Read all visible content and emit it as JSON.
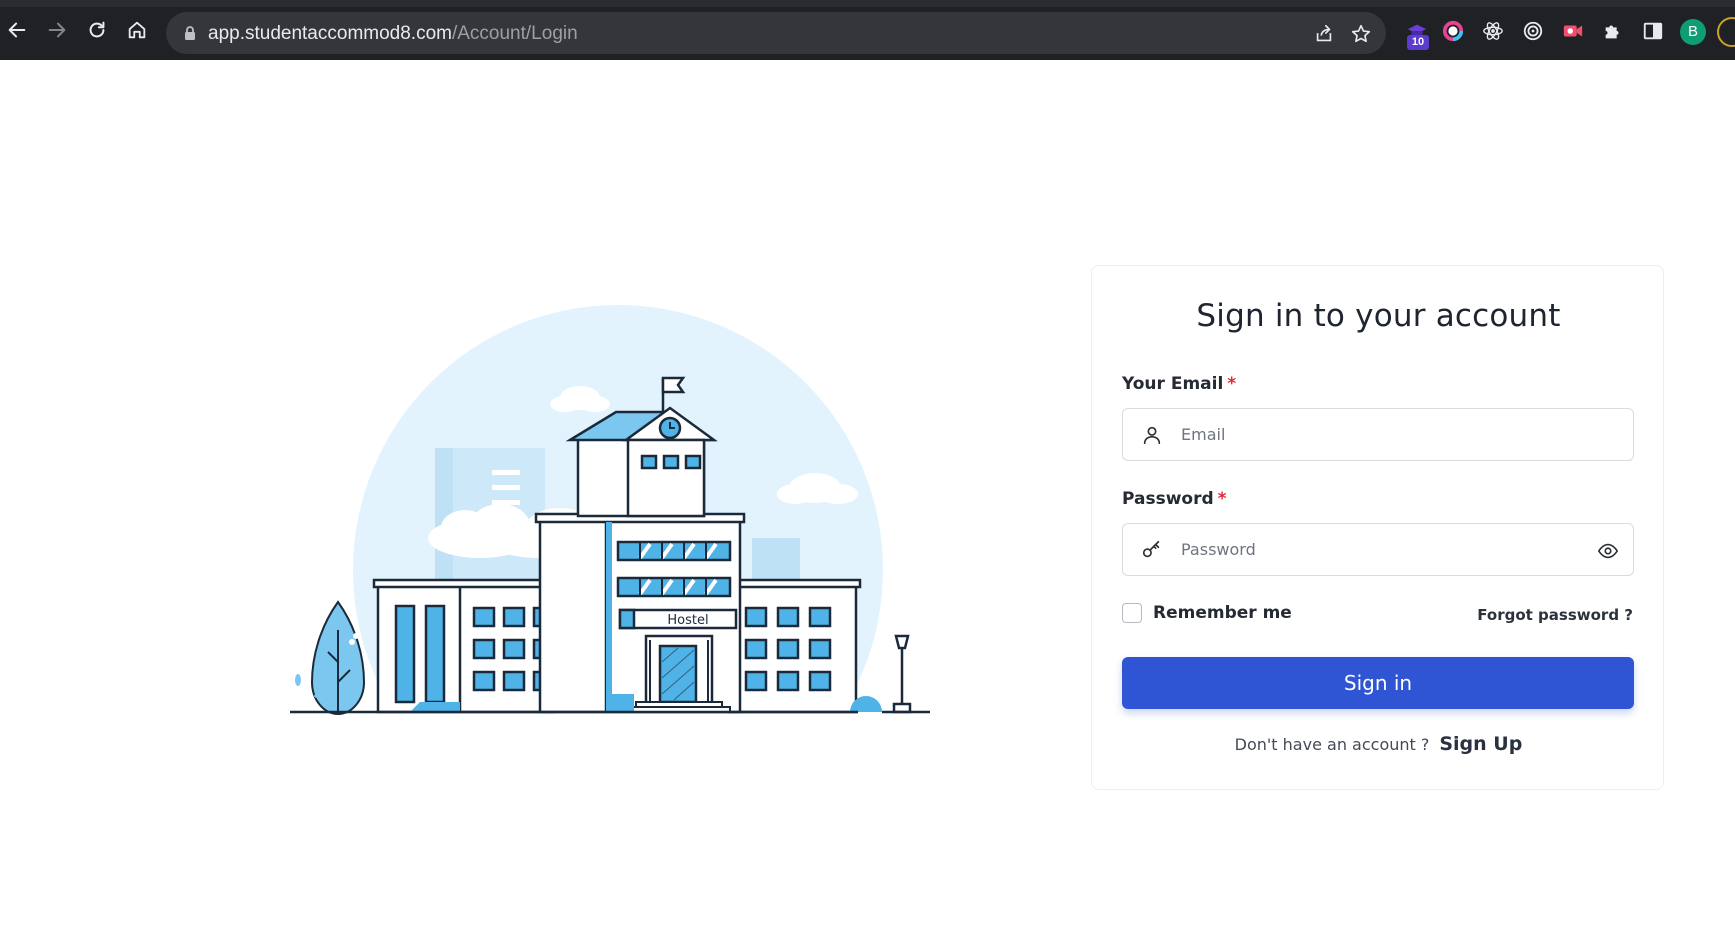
{
  "browser": {
    "url_host": "app.studentaccommod8.com",
    "url_path": "/Account/Login",
    "extension_badge": "10",
    "avatar_initial": "B"
  },
  "illustration": {
    "building_sign": "Hostel"
  },
  "login": {
    "title": "Sign in to your account",
    "email_label": "Your Email",
    "email_placeholder": "Email",
    "required_marker": "*",
    "password_label": "Password",
    "password_placeholder": "Password",
    "remember_label": "Remember me",
    "forgot_label": "Forgot password ?",
    "signin_label": "Sign in",
    "signup_question": "Don't have an account ?",
    "signup_label": "Sign Up"
  },
  "colors": {
    "primary": "#2f55d4",
    "required": "#e0293a",
    "illustration_blue": "#4fb3e8",
    "illustration_pale": "#e3f3fd",
    "chrome_bg": "#202124"
  }
}
